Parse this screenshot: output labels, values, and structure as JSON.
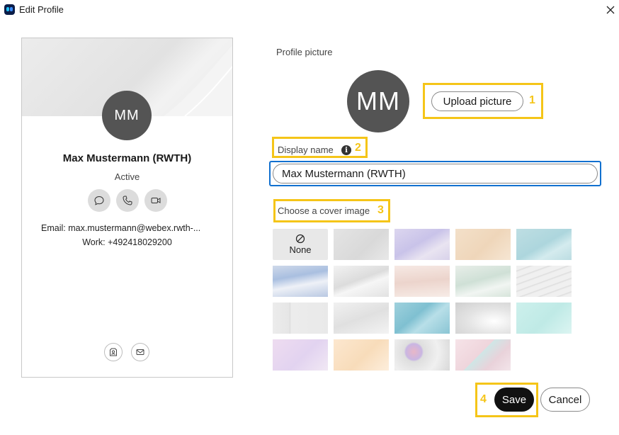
{
  "window": {
    "title": "Edit Profile",
    "app_icon": "webex-app-icon",
    "close_icon": "close-icon"
  },
  "card": {
    "initials": "MM",
    "name": "Max Mustermann (RWTH)",
    "status": "Active",
    "email_line": "Email: max.mustermann@webex.rwth-...",
    "work_line": "Work: +492418029200",
    "actions": [
      "chat-icon",
      "phone-icon",
      "video-icon"
    ],
    "bottom_actions": [
      "contact-card-icon",
      "mail-icon"
    ]
  },
  "profile_picture": {
    "label": "Profile picture",
    "initials": "MM",
    "upload_label": "Upload picture"
  },
  "display_name": {
    "label": "Display name",
    "info_icon": "info-icon",
    "info_glyph": "i",
    "value": "Max Mustermann (RWTH)"
  },
  "cover": {
    "label": "Choose a cover image",
    "none_label": "None",
    "none_icon": "prohibited-icon",
    "selected": "None"
  },
  "annotations": [
    "1",
    "2",
    "3",
    "4"
  ],
  "footer": {
    "save_label": "Save",
    "cancel_label": "Cancel"
  },
  "colors": {
    "accent_focus": "#1170cf",
    "callout": "#f5c518",
    "avatar_bg": "#545454",
    "primary_button": "#111111"
  }
}
